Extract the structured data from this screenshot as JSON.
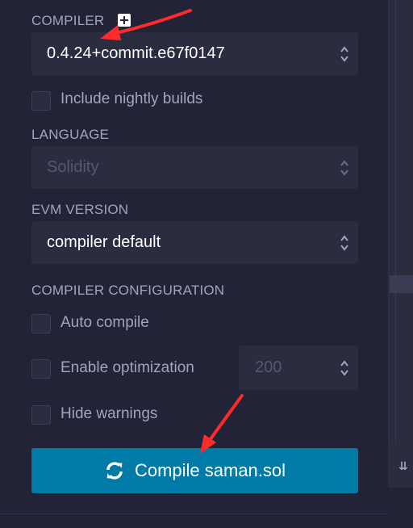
{
  "compiler": {
    "label": "COMPILER",
    "version": "0.4.24+commit.e67f0147",
    "nightly_label": "Include nightly builds"
  },
  "language": {
    "label": "LANGUAGE",
    "value": "Solidity"
  },
  "evm": {
    "label": "EVM VERSION",
    "value": "compiler default"
  },
  "config": {
    "label": "COMPILER CONFIGURATION",
    "auto_compile": "Auto compile",
    "optimization": "Enable optimization",
    "runs": "200",
    "hide_warnings": "Hide warnings"
  },
  "compile_button": {
    "label": "Compile saman.sol"
  },
  "colors": {
    "background": "#222336",
    "input": "#2a2c3f",
    "label": "#a2a3bd",
    "primary": "#007aa6",
    "annotation": "#ff2a2a"
  },
  "icons": {
    "add_compiler": "plus-square-icon",
    "compile": "refresh-icon",
    "collapse": "double-chevron-down-icon"
  }
}
